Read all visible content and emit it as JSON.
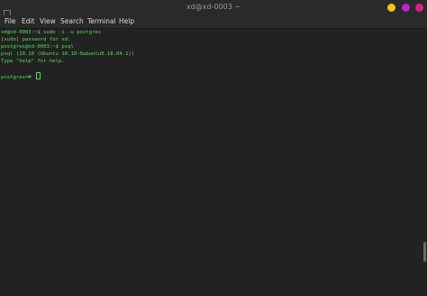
{
  "window": {
    "title": "xd@xd-0003 ~"
  },
  "menubar": {
    "items": [
      "File",
      "Edit",
      "View",
      "Search",
      "Terminal",
      "Help"
    ]
  },
  "terminal": {
    "lines": [
      "xd@xd-0003:~$ sudo -i -u postgres",
      "[sudo] password for xd:",
      "postgres@xd-0003:~$ psql",
      "psql (10.10 (Ubuntu 10.10-0ubuntu0.18.04.1))",
      "Type \"help\" for help.",
      "",
      "postgres=# "
    ]
  },
  "colors": {
    "minimize": "#f5c211",
    "maximize": "#c020d0",
    "close": "#e01b84",
    "terminal_text": "#4fe04f",
    "terminal_bg": "#222222"
  },
  "icons": {
    "window_menu": "terminal-icon",
    "minimize": "minimize-icon",
    "maximize": "maximize-icon",
    "close": "close-icon"
  }
}
